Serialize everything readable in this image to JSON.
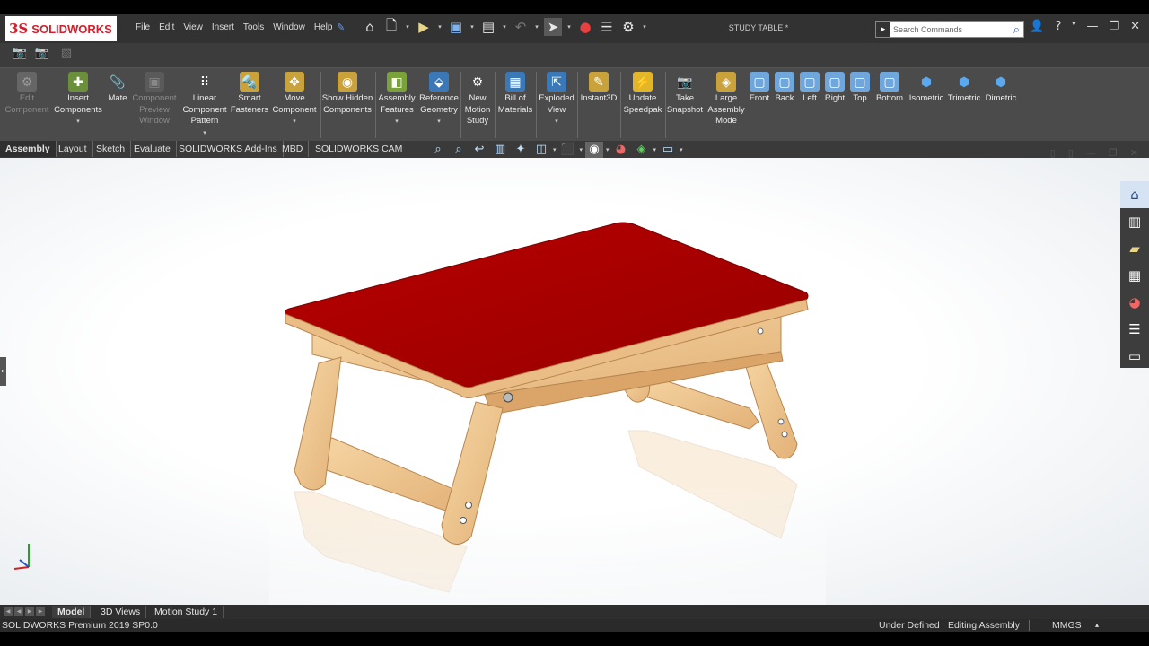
{
  "app": {
    "brand": "SOLIDWORKS",
    "doc_title": "STUDY TABLE *"
  },
  "menu": [
    "File",
    "Edit",
    "View",
    "Insert",
    "Tools",
    "Window",
    "Help"
  ],
  "search": {
    "placeholder": "Search Commands"
  },
  "ribbon": {
    "edit_component": "Edit Component",
    "insert_components": "Insert Components",
    "mate": "Mate",
    "component_preview_window": "Component Preview Window",
    "linear_component_pattern": "Linear Component Pattern",
    "smart_fasteners": "Smart Fasteners",
    "move_component": "Move Component",
    "show_hidden_components": "Show Hidden Components",
    "assembly_features": "Assembly Features",
    "reference_geometry": "Reference Geometry",
    "new_motion_study": "New Motion Study",
    "bill_of_materials": "Bill of Materials",
    "exploded_view": "Exploded View",
    "instant3d": "Instant3D",
    "update_speedpak": "Update Speedpak",
    "take_snapshot": "Take Snapshot",
    "large_assembly_mode": "Large Assembly Mode",
    "front": "Front",
    "back": "Back",
    "left": "Left",
    "right": "Right",
    "top": "Top",
    "bottom": "Bottom",
    "isometric": "Isometric",
    "trimetric": "Trimetric",
    "dimetric": "Dimetric"
  },
  "tabs": [
    "Assembly",
    "Layout",
    "Sketch",
    "Evaluate",
    "SOLIDWORKS Add-Ins",
    "MBD",
    "SOLIDWORKS CAM"
  ],
  "bottom_tabs": [
    "Model",
    "3D Views",
    "Motion Study 1"
  ],
  "status": {
    "product": "SOLIDWORKS Premium 2019 SP0.0",
    "definition": "Under Defined",
    "mode": "Editing Assembly",
    "units": "MMGS"
  },
  "colors": {
    "table_top": "#a50000",
    "wood": "#f0c890",
    "ribbon_bg": "#4b4b4b"
  },
  "icons": {
    "qat": [
      "home-icon",
      "new-document-icon",
      "open-icon",
      "save-icon",
      "print-icon",
      "undo-icon",
      "select-icon",
      "rebuild-icon",
      "file-properties-icon",
      "options-icon"
    ],
    "taskpane": [
      "solidworks-resources-icon",
      "design-library-icon",
      "file-explorer-icon",
      "view-palette-icon",
      "appearances-icon",
      "custom-properties-icon",
      "forum-icon"
    ]
  }
}
